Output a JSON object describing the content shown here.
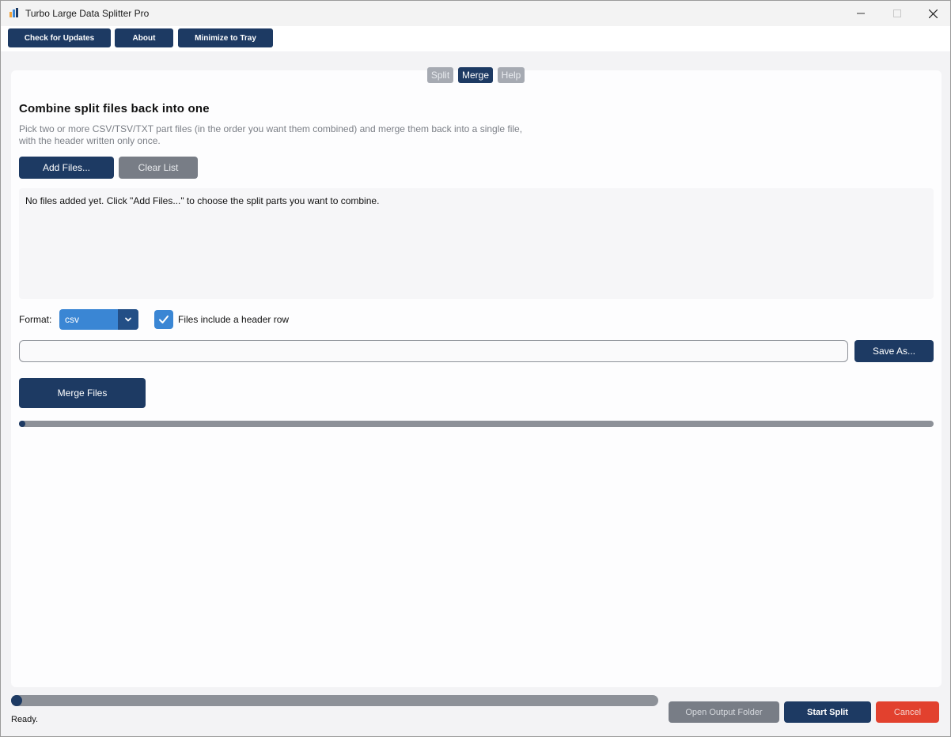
{
  "window": {
    "title": "Turbo Large Data Splitter Pro"
  },
  "toolbar": {
    "check_updates": "Check for Updates",
    "about": "About",
    "minimize_tray": "Minimize to Tray"
  },
  "tabs": [
    {
      "label": "Split",
      "active": false
    },
    {
      "label": "Merge",
      "active": true
    },
    {
      "label": "Help",
      "active": false
    }
  ],
  "merge": {
    "heading": "Combine split files back into one",
    "description": "Pick two or more CSV/TSV/TXT part files (in the order you want them combined) and merge them back into a single file, with the header written only once.",
    "add_files": "Add Files...",
    "clear_list": "Clear List",
    "empty_list_text": "No files added yet. Click \"Add Files...\" to choose the split parts you want to combine.",
    "format_label": "Format:",
    "format_value": "csv",
    "header_checkbox_label": "Files include a header row",
    "header_checked": true,
    "output_path": "",
    "save_as": "Save As...",
    "merge_button": "Merge Files",
    "progress": 0
  },
  "footer": {
    "progress": 0,
    "status": "Ready.",
    "open_output": "Open Output Folder",
    "start_split": "Start Split",
    "cancel": "Cancel"
  },
  "colors": {
    "primary": "#1d3a63",
    "accent": "#3a86d4",
    "disabled": "#787d86",
    "danger": "#e2412e"
  }
}
